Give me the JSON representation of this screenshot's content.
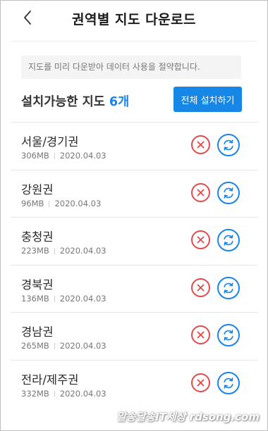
{
  "header": {
    "title": "권역별 지도 다운로드",
    "back_icon": "chevron-left-icon"
  },
  "notice": {
    "text": "지도를 미리 다운받아 데이터 사용을 절약합니다."
  },
  "available": {
    "label": "설치가능한 지도",
    "count": "6개"
  },
  "install_all": {
    "label": "전체 설치하기"
  },
  "regions": [
    {
      "name": "서울/경기권",
      "size": "306MB",
      "date": "2020.04.03"
    },
    {
      "name": "강원권",
      "size": "96MB",
      "date": "2020.04.03"
    },
    {
      "name": "충청권",
      "size": "223MB",
      "date": "2020.04.03"
    },
    {
      "name": "경북권",
      "size": "136MB",
      "date": "2020.04.03"
    },
    {
      "name": "경남권",
      "size": "265MB",
      "date": "2020.04.03"
    },
    {
      "name": "전라/제주권",
      "size": "332MB",
      "date": "2020.04.03"
    }
  ],
  "colors": {
    "accent": "#1b84e7",
    "delete": "#e24a4a"
  },
  "watermark": {
    "text": "알송달송IT세상 rdsong.com"
  }
}
